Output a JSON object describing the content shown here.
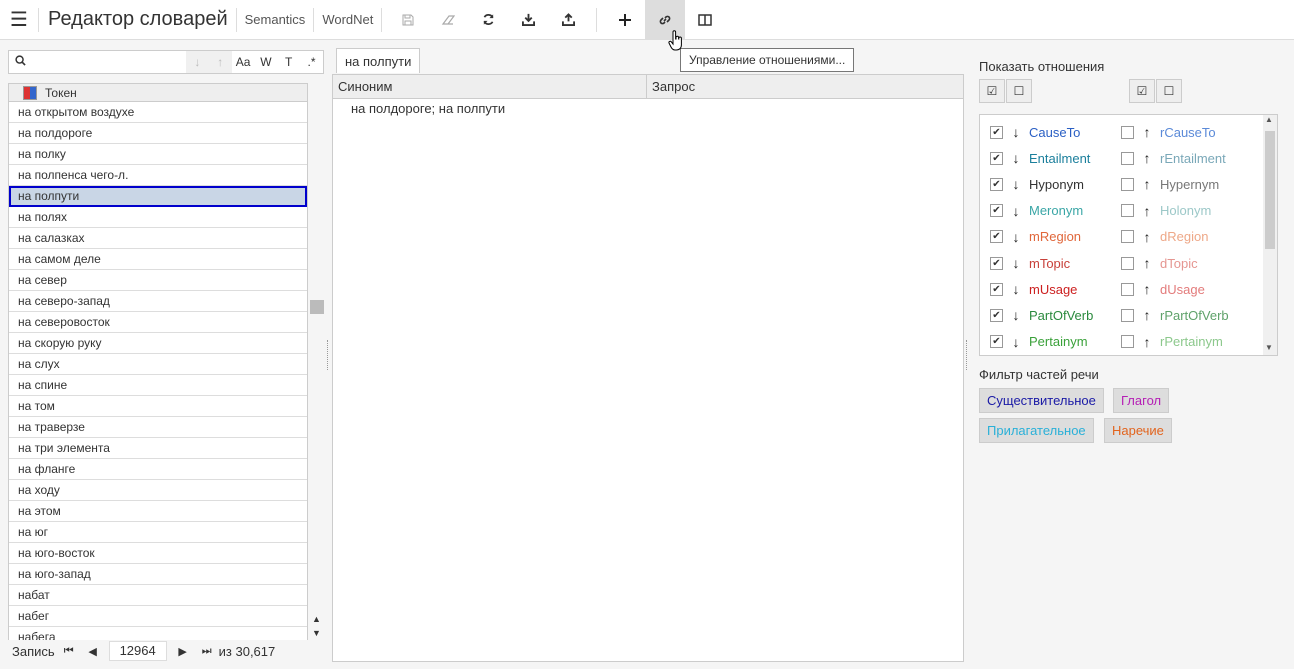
{
  "app": {
    "title": "Редактор словарей",
    "items": [
      "Semantics",
      "WordNet"
    ]
  },
  "tooltip": "Управление отношениями...",
  "left": {
    "search_placeholder": "",
    "search_buttons": [
      "↓",
      "↑",
      "Aa",
      "W",
      "T",
      ".*"
    ],
    "column": "Токен",
    "rows": [
      "на открытом воздухе",
      "на полдороге",
      "на полку",
      "на полпенса чего-л.",
      "на полпути",
      "на полях",
      "на салазках",
      "на самом деле",
      "на север",
      "на северо-запад",
      "на северовосток",
      "на скорую руку",
      "на слух",
      "на спине",
      "на том",
      "на траверзе",
      "на три элемента",
      "на фланге",
      "на ходу",
      "на этом",
      "на юг",
      "на юго-восток",
      "на юго-запад",
      "набат",
      "набег",
      "набега"
    ],
    "selected_index": 4,
    "pager": {
      "label": "Запись",
      "current": "12964",
      "total": "из 30,617"
    }
  },
  "mid": {
    "tab": "на полпути",
    "columns": [
      "Синоним",
      "Запрос"
    ],
    "rows": [
      "на полдороге; на полпути"
    ]
  },
  "right": {
    "show_label": "Показать отношения",
    "relations": [
      {
        "name": "CauseTo",
        "color": "#2a5fc4",
        "rname": "rCauseTo",
        "rcolor": "#5b8ad8",
        "checked": true
      },
      {
        "name": "Entailment",
        "color": "#1b7f9c",
        "rname": "rEntailment",
        "rcolor": "#7aa8b8",
        "checked": true
      },
      {
        "name": "Hyponym",
        "color": "#333333",
        "rname": "Hypernym",
        "rcolor": "#777777",
        "checked": true
      },
      {
        "name": "Meronym",
        "color": "#3aa6a6",
        "rname": "Holonym",
        "rcolor": "#9cc8c8",
        "checked": true
      },
      {
        "name": "mRegion",
        "color": "#e0663a",
        "rname": "dRegion",
        "rcolor": "#eea888",
        "checked": true
      },
      {
        "name": "mTopic",
        "color": "#c8413a",
        "rname": "dTopic",
        "rcolor": "#e59691",
        "checked": true
      },
      {
        "name": "mUsage",
        "color": "#cc1f1f",
        "rname": "dUsage",
        "rcolor": "#e37b7b",
        "checked": true
      },
      {
        "name": "PartOfVerb",
        "color": "#2b8a3e",
        "rname": "rPartOfVerb",
        "rcolor": "#5fa26a",
        "checked": true
      },
      {
        "name": "Pertainym",
        "color": "#3aa13a",
        "rname": "rPertainym",
        "rcolor": "#8cc88c",
        "checked": true
      }
    ],
    "pos_label": "Фильтр частей речи",
    "pos": [
      {
        "label": "Существительное",
        "color": "#1a1aa6"
      },
      {
        "label": "Глагол",
        "color": "#b51fb5"
      },
      {
        "label": "Прилагательное",
        "color": "#2ab0d8"
      },
      {
        "label": "Наречие",
        "color": "#e2641e"
      }
    ]
  }
}
